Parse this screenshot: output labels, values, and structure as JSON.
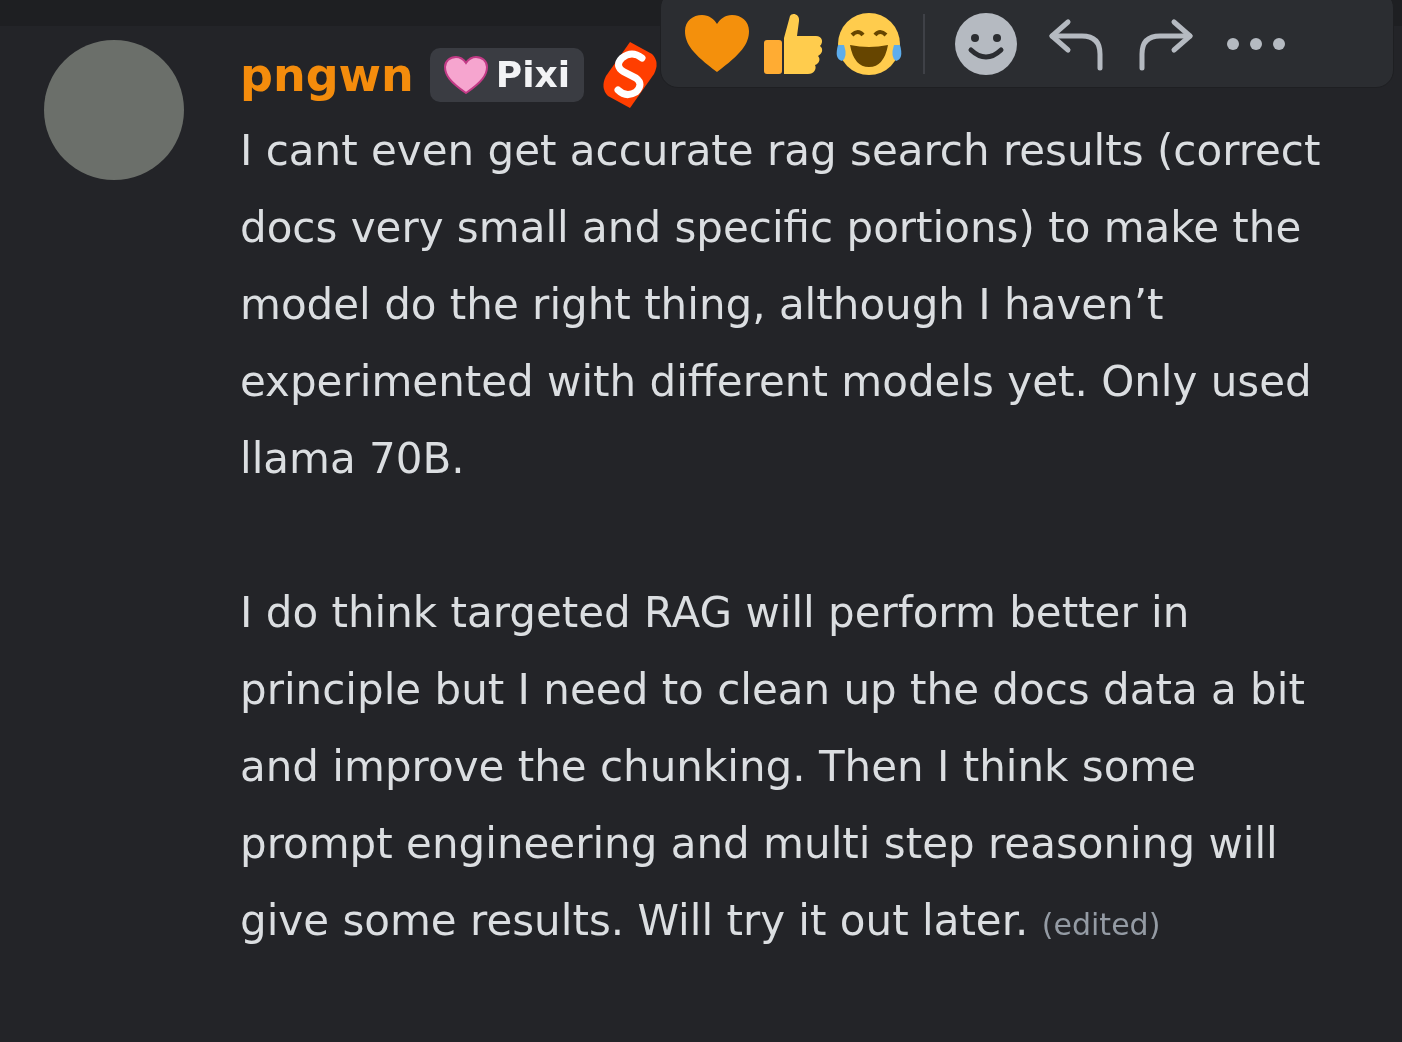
{
  "message": {
    "author": "pngwn",
    "badge": {
      "label": "Pixi"
    },
    "paragraphs": [
      "I cant even get accurate rag search results (correct docs very small and specific portions) to make the model do the right thing, although I haven’t experimented with different models yet. Only used llama 70B.",
      "I do think targeted RAG will perform better in principle but I need to clean up the docs data a bit and improve the chunking. Then I think some prompt engineering and multi step reasoning will give some results. Will try it out later."
    ],
    "edited": "(edited)"
  },
  "toolbar": {
    "reactions": [
      {
        "kind": "heart"
      },
      {
        "kind": "thumbs_up"
      },
      {
        "kind": "laugh"
      }
    ],
    "actions": [
      {
        "kind": "add_reaction"
      },
      {
        "kind": "reply"
      },
      {
        "kind": "forward"
      },
      {
        "kind": "more"
      }
    ]
  }
}
